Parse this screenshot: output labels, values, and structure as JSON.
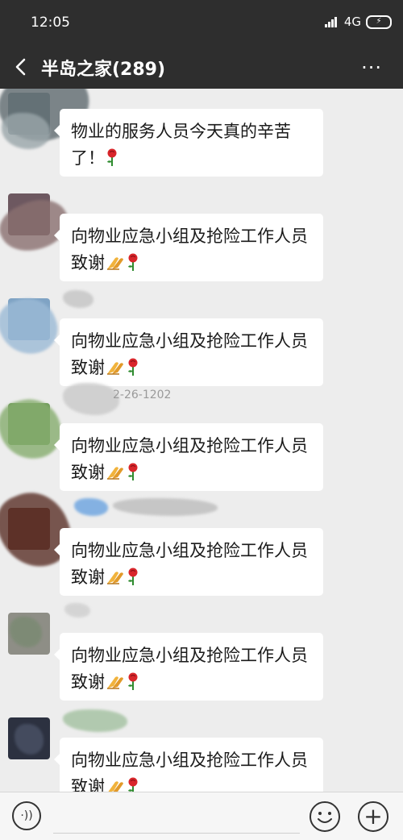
{
  "status_bar": {
    "time": "12:05",
    "network": "4G",
    "network_sub": "ıl"
  },
  "header": {
    "title": "半岛之家(289)",
    "back_icon": "chevron-left-icon",
    "more_icon": "more-dots-icon",
    "more_glyph": "···"
  },
  "messages": [
    {
      "sender": "",
      "text": "物业的服务人员今天真的辛苦了！",
      "emoji": [
        "rose"
      ]
    },
    {
      "sender": "",
      "text": "向物业应急小组及抢险工作人员致谢",
      "emoji": [
        "clap",
        "rose"
      ]
    },
    {
      "sender": "",
      "text": "向物业应急小组及抢险工作人员致谢",
      "emoji": [
        "clap",
        "rose"
      ]
    },
    {
      "sender": "2-26-1202",
      "text": "向物业应急小组及抢险工作人员致谢",
      "emoji": [
        "clap",
        "rose"
      ]
    },
    {
      "sender": "",
      "text": "向物业应急小组及抢险工作人员致谢",
      "emoji": [
        "clap",
        "rose"
      ]
    },
    {
      "sender": "",
      "text": "向物业应急小组及抢险工作人员致谢",
      "emoji": [
        "clap",
        "rose"
      ]
    },
    {
      "sender": "",
      "text": "向物业应急小组及抢险工作人员致谢",
      "emoji": [
        "clap",
        "rose"
      ]
    }
  ],
  "input_bar": {
    "voice_icon": "voice-icon",
    "emoji_icon": "emoji-face-icon",
    "plus_icon": "plus-icon",
    "voice_glyph": "·))",
    "plus_glyph": "+"
  },
  "colors": {
    "header_bg": "#2e2e2e",
    "chat_bg": "#ededed",
    "bubble_bg": "#ffffff",
    "text": "#1a1a1a"
  }
}
